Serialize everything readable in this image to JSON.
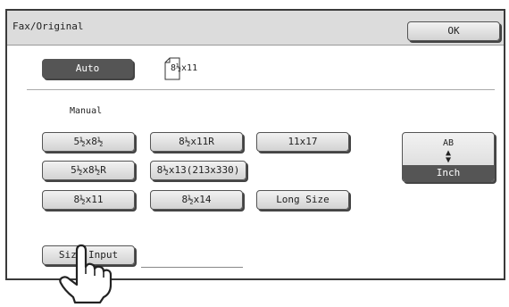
{
  "dialog": {
    "title": "Fax/Original",
    "ok_label": "OK"
  },
  "auto": {
    "label": "Auto",
    "detected_size": "8½x11"
  },
  "manual": {
    "label": "Manual",
    "sizes": [
      "5½x8½",
      "8½x11R",
      "11x17",
      "5½x8½R",
      "8½x13(213x330)",
      "8½x11",
      "8½x14",
      "Long Size"
    ]
  },
  "unit_toggle": {
    "top": "AB",
    "selected": "Inch"
  },
  "size_input_label": "Size Input",
  "icons": [
    "paper-portrait-icon",
    "up-down-arrows-icon",
    "pointing-hand-icon"
  ]
}
